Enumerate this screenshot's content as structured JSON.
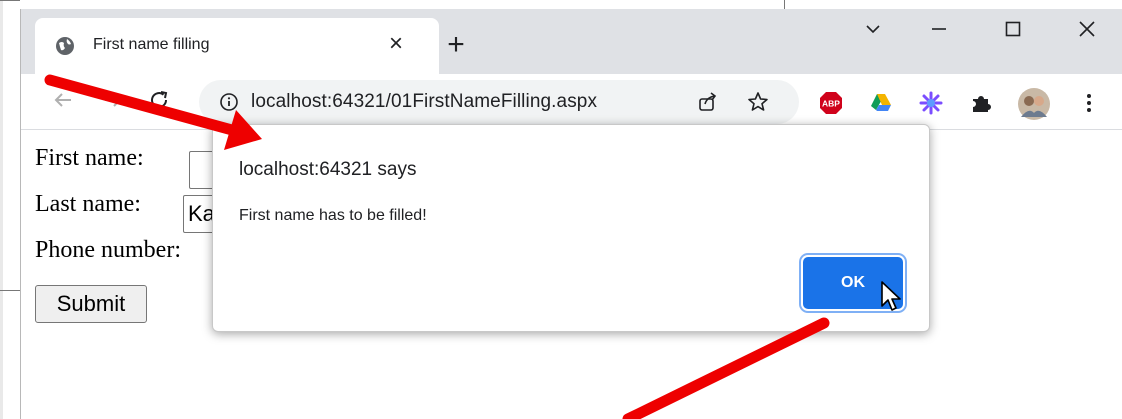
{
  "browser": {
    "tab": {
      "title": "First name filling"
    },
    "address_bar": {
      "url": "localhost:64321/01FirstNameFilling.aspx"
    },
    "extensions": [
      "abp-icon",
      "google-drive-icon",
      "star-burst-icon",
      "puzzle-icon",
      "profile-avatar"
    ],
    "abp_badge": "ABP"
  },
  "form": {
    "first_name_label": "First name:",
    "first_name_value": "",
    "last_name_label": "Last name:",
    "last_name_value": "Ka",
    "phone_label": "Phone number:",
    "submit_label": "Submit"
  },
  "dialog": {
    "title": "localhost:64321 says",
    "message": "First name has to be filled!",
    "ok_label": "OK"
  },
  "colors": {
    "accent": "#1a73e8",
    "annotation_arrow": "#ee0000"
  }
}
